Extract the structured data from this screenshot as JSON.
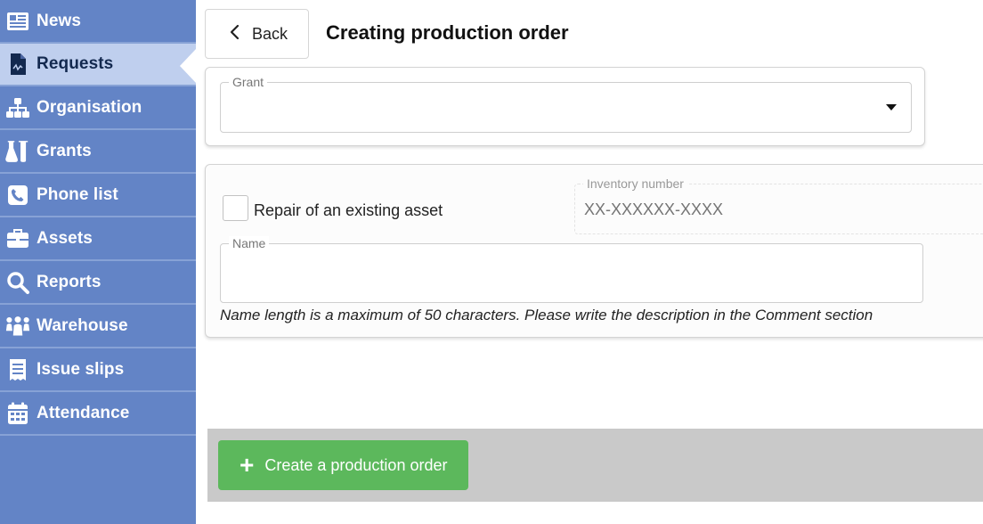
{
  "sidebar": {
    "items": [
      {
        "label": "News",
        "icon": "newspaper-icon",
        "active": false
      },
      {
        "label": "Requests",
        "icon": "document-icon",
        "active": true
      },
      {
        "label": "Organisation",
        "icon": "org-chart-icon",
        "active": false
      },
      {
        "label": "Grants",
        "icon": "flask-icon",
        "active": false
      },
      {
        "label": "Phone list",
        "icon": "phone-icon",
        "active": false
      },
      {
        "label": "Assets",
        "icon": "briefcase-icon",
        "active": false
      },
      {
        "label": "Reports",
        "icon": "search-icon",
        "active": false
      },
      {
        "label": "Warehouse",
        "icon": "people-icon",
        "active": false
      },
      {
        "label": "Issue slips",
        "icon": "receipt-icon",
        "active": false
      },
      {
        "label": "Attendance",
        "icon": "calendar-icon",
        "active": false
      }
    ]
  },
  "header": {
    "back_label": "Back",
    "title": "Creating production order"
  },
  "form": {
    "grant": {
      "label": "Grant",
      "value": ""
    },
    "repair_checkbox": {
      "label": "Repair of an existing asset",
      "checked": false
    },
    "inventory_number": {
      "label": "Inventory number",
      "placeholder": "XX-XXXXXX-XXXX",
      "value": ""
    },
    "name": {
      "label": "Name",
      "value": ""
    },
    "name_hint": "Name length is a maximum of 50 characters. Please write the description in the Comment section"
  },
  "footer": {
    "create_label": "Create a production order"
  },
  "colors": {
    "sidebar": "#6384c6",
    "active_item": "#bfcfee",
    "create_button": "#5cb85c"
  }
}
